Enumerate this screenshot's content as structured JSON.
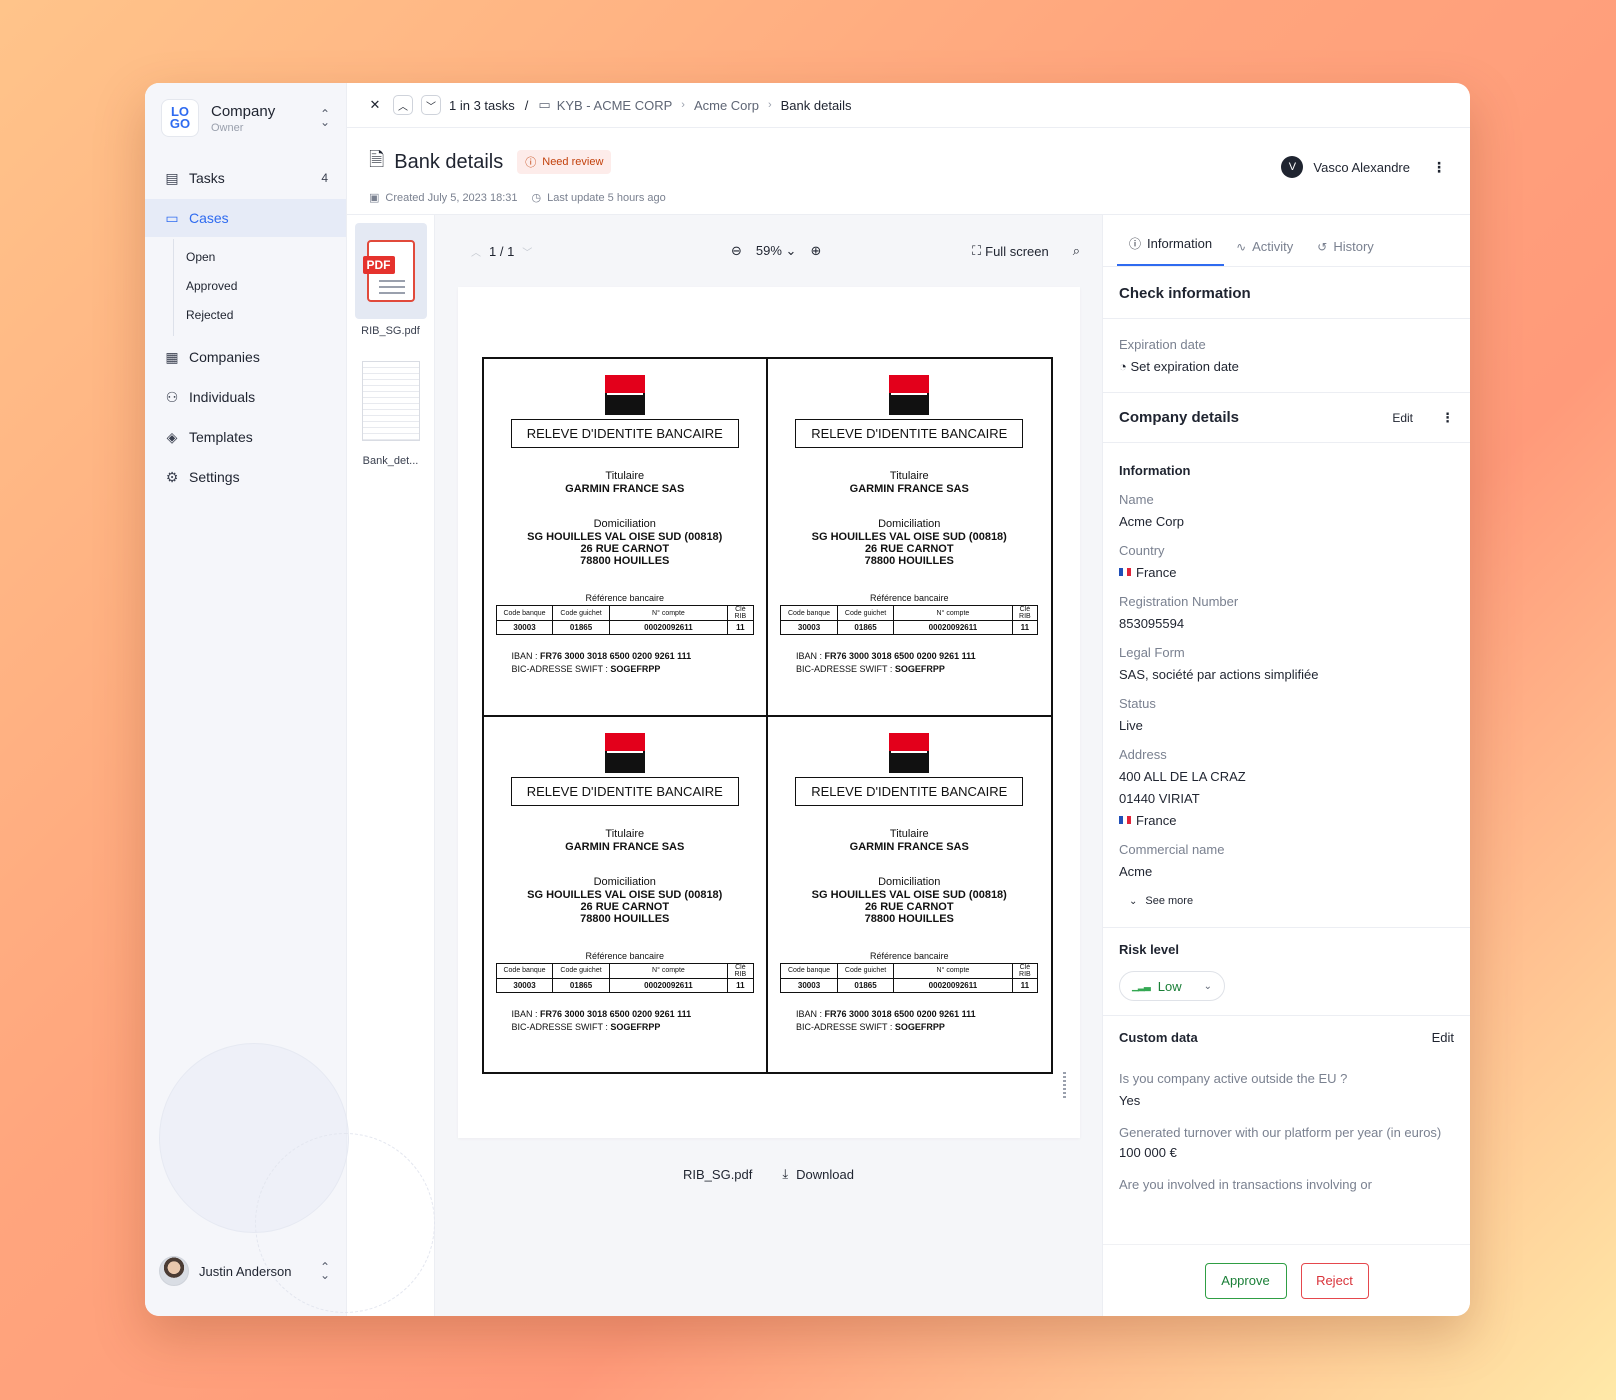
{
  "sidebar": {
    "company": {
      "name": "Company",
      "role": "Owner",
      "logo": "LO GO"
    },
    "nav": {
      "tasks": {
        "label": "Tasks",
        "count": "4"
      },
      "cases": {
        "label": "Cases"
      },
      "cases_sub": [
        "Open",
        "Approved",
        "Rejected"
      ],
      "companies": {
        "label": "Companies"
      },
      "individuals": {
        "label": "Individuals"
      },
      "templates": {
        "label": "Templates"
      },
      "settings": {
        "label": "Settings"
      }
    },
    "user": {
      "name": "Justin Anderson"
    }
  },
  "topbar": {
    "tasks_count": "1 in 3 tasks",
    "separator": "/",
    "breadcrumb": [
      "KYB - ACME CORP",
      "Acme Corp",
      "Bank details"
    ]
  },
  "header": {
    "title": "Bank details",
    "badge": "Need review",
    "created": "Created July 5, 2023 18:31",
    "updated": "Last update 5 hours ago",
    "assignee": {
      "initial": "V",
      "name": "Vasco Alexandre"
    }
  },
  "thumbnails": [
    {
      "label": "RIB_SG.pdf",
      "pdf_badge": "PDF"
    },
    {
      "label": "Bank_det..."
    }
  ],
  "viewer": {
    "page": "1 / 1",
    "zoom": "59%",
    "fullscreen": "Full screen",
    "file_name": "RIB_SG.pdf",
    "download": "Download"
  },
  "rib": {
    "title": "RELEVE D'IDENTITE BANCAIRE",
    "titulaire_label": "Titulaire",
    "titulaire": "GARMIN FRANCE SAS",
    "domiciliation_label": "Domiciliation",
    "dom_line1": "SG HOUILLES VAL OISE SUD (00818)",
    "dom_line2": "26 RUE CARNOT",
    "dom_line3": "78800 HOUILLES",
    "ref_label": "Référence bancaire",
    "col_headers": [
      "Code banque",
      "Code guichet",
      "N° compte",
      "Clé RIB"
    ],
    "col_values": [
      "30003",
      "01865",
      "00020092611",
      "11"
    ],
    "iban_label": "IBAN :",
    "iban": "FR76 3000 3018 6500 0200 9261 111",
    "bic_label": "BIC-ADRESSE SWIFT :",
    "bic": "SOGEFRPP"
  },
  "panel": {
    "tabs": [
      "Information",
      "Activity",
      "History"
    ],
    "check": {
      "title": "Check information",
      "expiration_label": "Expiration date",
      "expiration_action": "Set expiration date"
    },
    "company": {
      "title": "Company details",
      "edit": "Edit",
      "subtitle": "Information",
      "name_label": "Name",
      "name": "Acme Corp",
      "country_label": "Country",
      "country": "France",
      "reg_label": "Registration Number",
      "reg": "853095594",
      "legal_label": "Legal Form",
      "legal": "SAS, société par actions simplifiée",
      "status_label": "Status",
      "status": "Live",
      "address_label": "Address",
      "address1": "400 ALL DE LA CRAZ",
      "address2": "01440 VIRIAT",
      "address3": "France",
      "commercial_label": "Commercial name",
      "commercial": "Acme",
      "see_more": "See more"
    },
    "risk": {
      "title": "Risk level",
      "value": "Low"
    },
    "custom": {
      "title": "Custom data",
      "edit": "Edit",
      "q1": "Is you company active outside the EU ?",
      "a1": "Yes",
      "q2": "Generated turnover with our platform per year (in euros)",
      "a2": "100 000 €",
      "q3": "Are you involved in transactions involving or"
    },
    "approve": "Approve",
    "reject": "Reject"
  },
  "colors": {
    "accent": "#2f6bf0",
    "approve": "#2f9e44",
    "reject": "#e5484d",
    "badge_bg": "#fdecea",
    "badge_text": "#c2410c"
  }
}
